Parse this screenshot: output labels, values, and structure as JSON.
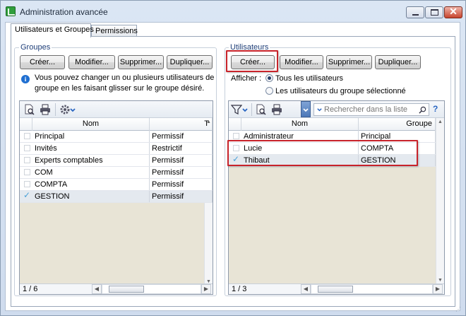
{
  "window": {
    "title": "Administration avancée",
    "min_symbol": "—",
    "max_symbol": "▢",
    "close_symbol": "✕"
  },
  "tabs": [
    {
      "label": "Utilisateurs et Groupes",
      "active": true
    },
    {
      "label": "Permissions",
      "active": false
    }
  ],
  "groups_panel": {
    "title": "Groupes",
    "buttons": [
      "Créer...",
      "Modifier...",
      "Supprimer...",
      "Dupliquer..."
    ],
    "info_text_line1": "Vous pouvez changer un ou plusieurs utilisateurs de",
    "info_text_line2": "groupe en les faisant glisser sur le groupe désiré.",
    "grid": {
      "columns": [
        "Nom",
        "T"
      ],
      "rows": [
        {
          "name": "Principal",
          "type": "Permissif",
          "checked": false,
          "selected": false
        },
        {
          "name": "Invités",
          "type": "Restrictif",
          "checked": false,
          "selected": false
        },
        {
          "name": "Experts comptables",
          "type": "Permissif",
          "checked": false,
          "selected": false
        },
        {
          "name": "COM",
          "type": "Permissif",
          "checked": false,
          "selected": false
        },
        {
          "name": "COMPTA",
          "type": "Permissif",
          "checked": false,
          "selected": false
        },
        {
          "name": "GESTION",
          "type": "Permissif",
          "checked": true,
          "selected": true
        }
      ],
      "status": "1 / 6"
    }
  },
  "users_panel": {
    "title": "Utilisateurs",
    "buttons": [
      "Créer...",
      "Modifier...",
      "Supprimer...",
      "Dupliquer..."
    ],
    "show_label": "Afficher :",
    "radio_options": [
      {
        "label": "Tous les utilisateurs",
        "selected": true
      },
      {
        "label": "Les utilisateurs du groupe sélectionné",
        "selected": false
      }
    ],
    "search_placeholder": "Rechercher dans la liste",
    "help_symbol": "?",
    "grid": {
      "columns": [
        "Nom",
        "Groupe"
      ],
      "rows": [
        {
          "name": "Administrateur",
          "group": "Principal",
          "checked": false,
          "selected": false
        },
        {
          "name": "Lucie",
          "group": "COMPTA",
          "checked": false,
          "selected": false
        },
        {
          "name": "Thibaut",
          "group": "GESTION",
          "checked": true,
          "selected": true
        }
      ],
      "status": "1 / 3"
    }
  },
  "icons": {
    "left_toolbar": [
      "preview-icon",
      "print-icon",
      "gear-icon",
      "chevron-down-icon"
    ],
    "right_toolbar": [
      "filter-icon",
      "chevron-down-icon",
      "preview-icon",
      "print-icon",
      "dropdown-icon",
      "search-icon",
      "help-icon"
    ]
  },
  "colors": {
    "highlight": "#c8232a",
    "info": "#1f6fd1",
    "group_title": "#1e3e78"
  }
}
